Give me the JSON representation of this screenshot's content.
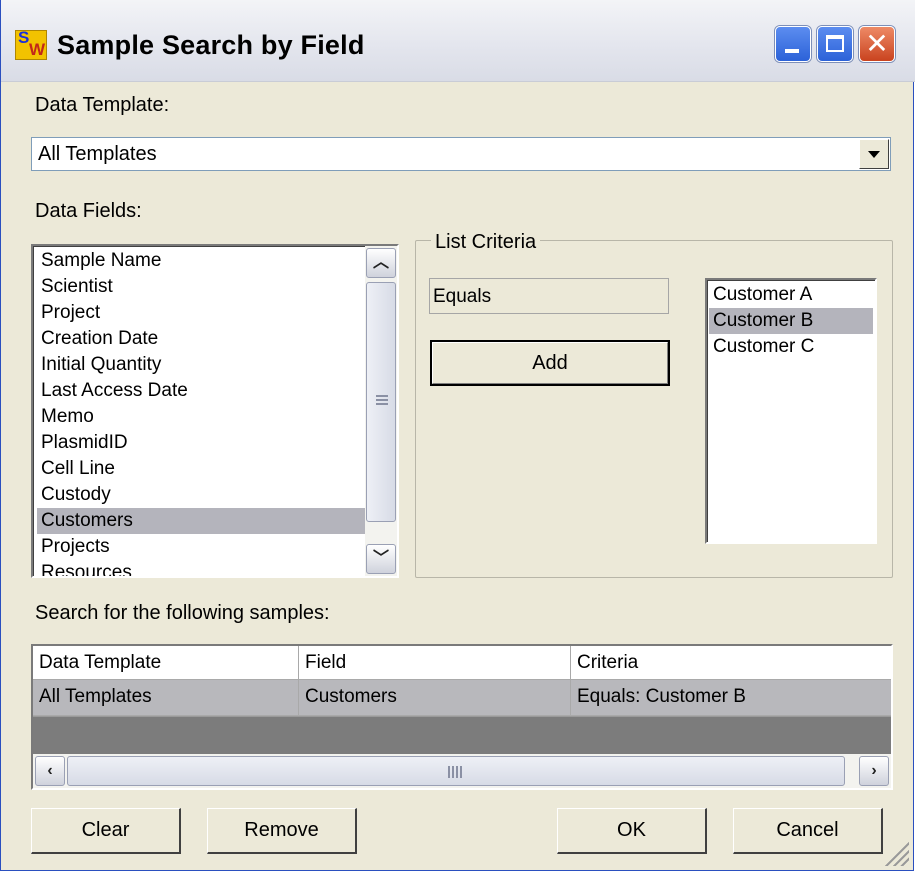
{
  "window": {
    "title": "Sample Search by Field",
    "app_icon": "sw-app-icon",
    "controls": [
      "minimize-icon",
      "maximize-icon",
      "close-icon"
    ]
  },
  "template": {
    "label": "Data Template:",
    "selected": "All Templates"
  },
  "fields": {
    "label": "Data Fields:",
    "items": [
      "Sample Name",
      "Scientist",
      "Project",
      "Creation Date",
      "Initial Quantity",
      "Last Access Date",
      "Memo",
      "PlasmidID",
      "Cell Line",
      "Custody",
      "Customers",
      "Projects",
      "Resources"
    ],
    "selected_index": 10
  },
  "list_criteria": {
    "title": "List Criteria",
    "operator": "Equals",
    "add_label": "Add",
    "values": [
      "Customer A",
      "Customer B",
      "Customer C"
    ],
    "selected_index": 1
  },
  "search": {
    "label": "Search for the following samples:",
    "columns": [
      "Data Template",
      "Field",
      "Criteria"
    ],
    "rows": [
      [
        "All Templates",
        "Customers",
        "Equals: Customer B"
      ]
    ]
  },
  "buttons": {
    "clear": "Clear",
    "remove": "Remove",
    "ok": "OK",
    "cancel": "Cancel"
  },
  "colors": {
    "dialog_bg": "#ece9d8",
    "selection": "#b4b4bc",
    "grid_empty": "#7c7c7c"
  }
}
